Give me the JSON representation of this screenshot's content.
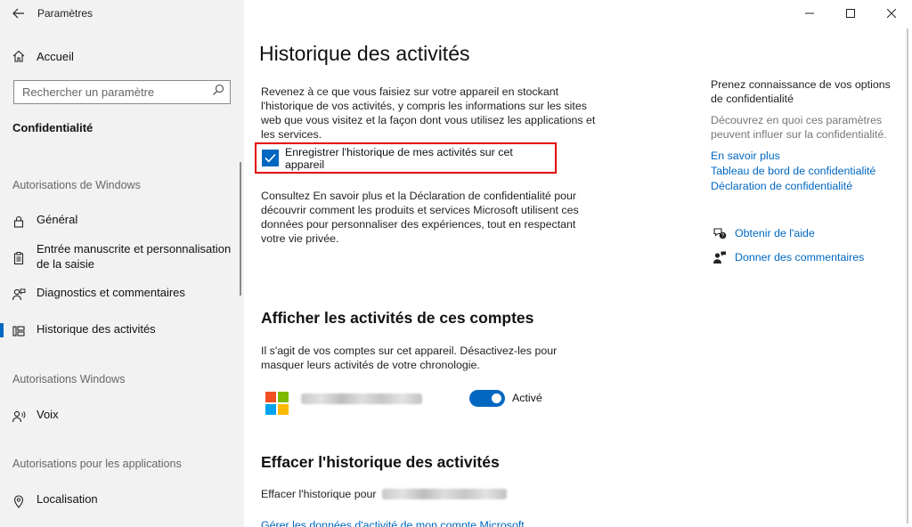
{
  "app": {
    "title": "Paramètres"
  },
  "sidebar": {
    "home_label": "Accueil",
    "search_placeholder": "Rechercher un paramètre",
    "section_title": "Confidentialité",
    "groups": [
      {
        "heading": "Autorisations de Windows"
      },
      {
        "heading": "Autorisations Windows"
      },
      {
        "heading": "Autorisations pour les applications"
      }
    ],
    "items": [
      {
        "label": "Général",
        "icon": "lock-icon"
      },
      {
        "label": "Entrée manuscrite et personnalisation de la saisie",
        "icon": "clipboard-icon"
      },
      {
        "label": "Diagnostics et commentaires",
        "icon": "person-feedback-icon"
      },
      {
        "label": "Historique des activités",
        "icon": "timeline-icon",
        "active": true
      },
      {
        "label": "Voix",
        "icon": "voice-icon"
      },
      {
        "label": "Localisation",
        "icon": "location-icon"
      }
    ]
  },
  "main": {
    "title": "Historique des activités",
    "intro": "Revenez à ce que vous faisiez sur votre appareil en stockant l'historique de vos activités, y compris les informations sur les sites web que vous visitez et la façon dont vous utilisez les applications et les services.",
    "checkbox": {
      "label": "Enregistrer l'historique de mes activités sur cet appareil",
      "checked": true
    },
    "consult_text": "Consultez En savoir plus et la Déclaration de confidentialité pour découvrir comment les produits et services Microsoft utilisent ces données pour personnaliser des expériences, tout en respectant votre vie privée.",
    "accounts_heading": "Afficher les activités de ces comptes",
    "accounts_desc": "Il s'agit de vos comptes sur cet appareil. Désactivez-les pour masquer leurs activités de votre chronologie.",
    "account_toggle": {
      "label": "Activé",
      "on": true
    },
    "clear_heading": "Effacer l'historique des activités",
    "clear_label": "Effacer l'historique pour",
    "manage_link": "Gérer les données d'activité de mon compte Microsoft"
  },
  "right": {
    "title": "Prenez connaissance de vos options de confidentialité",
    "subtitle": "Découvrez en quoi ces paramètres peuvent influer sur la confidentialité.",
    "links": [
      "En savoir plus",
      "Tableau de bord de confidentialité",
      "Déclaration de confidentialité"
    ],
    "help_label": "Obtenir de l'aide",
    "feedback_label": "Donner des commentaires"
  },
  "colors": {
    "accent": "#0067c0",
    "highlight_border": "#e00000"
  }
}
